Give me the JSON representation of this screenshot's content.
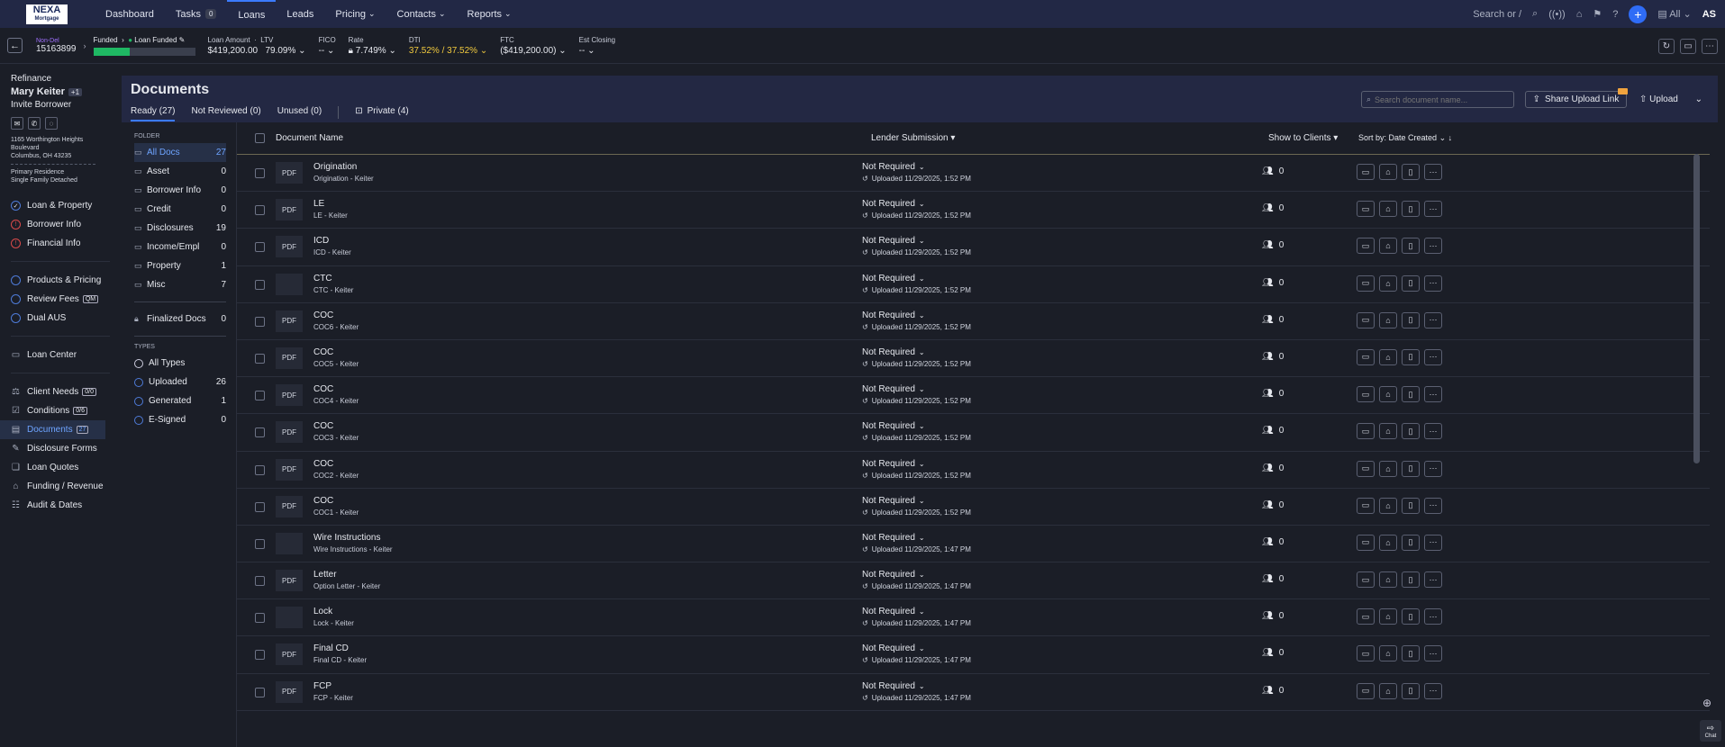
{
  "nav": {
    "logo_main": "NEXA",
    "logo_sub": "Mortgage",
    "items": [
      {
        "label": "Dashboard"
      },
      {
        "label": "Tasks",
        "badge": "0"
      },
      {
        "label": "Loans"
      },
      {
        "label": "Leads"
      },
      {
        "label": "Pricing",
        "chevron": "⌄"
      },
      {
        "label": "Contacts",
        "chevron": "⌄"
      },
      {
        "label": "Reports",
        "chevron": "⌄"
      }
    ],
    "search_placeholder": "Search or /",
    "scope": "All",
    "user_initials": "AS"
  },
  "status": {
    "loan_type_label": "Non-Del",
    "loan_number": "15163899",
    "stage": "Funded",
    "milestone": "Loan Funded",
    "loan_amount_label": "Loan Amount",
    "loan_amount": "$419,200.00",
    "ltv_label": "LTV",
    "ltv": "79.09%",
    "fico_label": "FICO",
    "fico": "--",
    "rate_label": "Rate",
    "rate": "7.749%",
    "dti_label": "DTI",
    "dti": "37.52% / 37.52%",
    "ftc_label": "FTC",
    "ftc": "($419,200.00)",
    "est_closing_label": "Est Closing",
    "est_closing": "--"
  },
  "borrower": {
    "purpose": "Refinance",
    "name": "Mary Keiter",
    "extra": "+1",
    "invite": "Invite Borrower",
    "address1": "1165 Worthington Heights",
    "address2": "Boulevard",
    "address3": "Columbus, OH 43235",
    "occupancy": "Primary Residence",
    "property_type": "Single Family Detached"
  },
  "sidebar": {
    "group1": [
      "Loan & Property",
      "Borrower Info",
      "Financial Info"
    ],
    "group2": [
      "Products & Pricing",
      "Review Fees",
      "Dual AUS"
    ],
    "review_fees_tag": "QM",
    "loan_center": "Loan Center",
    "group3": [
      {
        "label": "Client Needs",
        "tag": "0/0"
      },
      {
        "label": "Conditions",
        "tag": "0/6"
      },
      {
        "label": "Documents",
        "tag": "27"
      },
      {
        "label": "Disclosure Forms",
        "tag": ""
      },
      {
        "label": "Loan Quotes",
        "tag": ""
      },
      {
        "label": "Funding / Revenue",
        "tag": ""
      },
      {
        "label": "Audit & Dates",
        "tag": ""
      }
    ]
  },
  "docs": {
    "title": "Documents",
    "tabs": [
      "Ready (27)",
      "Not Reviewed (0)",
      "Unused (0)"
    ],
    "private_tab": "Private (4)",
    "search_placeholder": "Search document name...",
    "share_label": "Share Upload Link",
    "upload_label": "Upload"
  },
  "folders": {
    "label": "FOLDER",
    "items": [
      {
        "label": "All Docs",
        "count": "27"
      },
      {
        "label": "Asset",
        "count": "0"
      },
      {
        "label": "Borrower Info",
        "count": "0"
      },
      {
        "label": "Credit",
        "count": "0"
      },
      {
        "label": "Disclosures",
        "count": "19"
      },
      {
        "label": "Income/Empl",
        "count": "0"
      },
      {
        "label": "Property",
        "count": "1"
      },
      {
        "label": "Misc",
        "count": "7"
      }
    ],
    "finalized": {
      "label": "Finalized Docs",
      "count": "0"
    },
    "types_label": "TYPES",
    "types": [
      {
        "label": "All Types",
        "count": ""
      },
      {
        "label": "Uploaded",
        "count": "26"
      },
      {
        "label": "Generated",
        "count": "1"
      },
      {
        "label": "E-Signed",
        "count": "0"
      }
    ]
  },
  "table": {
    "col_name": "Document Name",
    "col_lender": "Lender Submission",
    "col_show": "Show to Clients",
    "sort_label": "Sort by:",
    "sort_value": "Date Created",
    "rows": [
      {
        "pdf": "PDF",
        "name": "Origination",
        "sub": "Origination - Keiter",
        "status": "Not Required",
        "uploaded": "Uploaded 11/29/2025, 1:52 PM",
        "share": "0"
      },
      {
        "pdf": "PDF",
        "name": "LE",
        "sub": "LE - Keiter",
        "status": "Not Required",
        "uploaded": "Uploaded 11/29/2025, 1:52 PM",
        "share": "0"
      },
      {
        "pdf": "PDF",
        "name": "ICD",
        "sub": "ICD - Keiter",
        "status": "Not Required",
        "uploaded": "Uploaded 11/29/2025, 1:52 PM",
        "share": "0"
      },
      {
        "pdf": "",
        "name": "CTC",
        "sub": "CTC - Keiter",
        "status": "Not Required",
        "uploaded": "Uploaded 11/29/2025, 1:52 PM",
        "share": "0"
      },
      {
        "pdf": "PDF",
        "name": "COC",
        "sub": "COC6 - Keiter",
        "status": "Not Required",
        "uploaded": "Uploaded 11/29/2025, 1:52 PM",
        "share": "0"
      },
      {
        "pdf": "PDF",
        "name": "COC",
        "sub": "COC5 - Keiter",
        "status": "Not Required",
        "uploaded": "Uploaded 11/29/2025, 1:52 PM",
        "share": "0"
      },
      {
        "pdf": "PDF",
        "name": "COC",
        "sub": "COC4 - Keiter",
        "status": "Not Required",
        "uploaded": "Uploaded 11/29/2025, 1:52 PM",
        "share": "0"
      },
      {
        "pdf": "PDF",
        "name": "COC",
        "sub": "COC3 - Keiter",
        "status": "Not Required",
        "uploaded": "Uploaded 11/29/2025, 1:52 PM",
        "share": "0"
      },
      {
        "pdf": "PDF",
        "name": "COC",
        "sub": "COC2 - Keiter",
        "status": "Not Required",
        "uploaded": "Uploaded 11/29/2025, 1:52 PM",
        "share": "0"
      },
      {
        "pdf": "PDF",
        "name": "COC",
        "sub": "COC1 - Keiter",
        "status": "Not Required",
        "uploaded": "Uploaded 11/29/2025, 1:52 PM",
        "share": "0"
      },
      {
        "pdf": "",
        "name": "Wire Instructions",
        "sub": "Wire Instructions - Keiter",
        "status": "Not Required",
        "uploaded": "Uploaded 11/29/2025, 1:47 PM",
        "share": "0"
      },
      {
        "pdf": "PDF",
        "name": "Letter",
        "sub": "Option Letter - Keiter",
        "status": "Not Required",
        "uploaded": "Uploaded 11/29/2025, 1:47 PM",
        "share": "0"
      },
      {
        "pdf": "",
        "name": "Lock",
        "sub": "Lock - Keiter",
        "status": "Not Required",
        "uploaded": "Uploaded 11/29/2025, 1:47 PM",
        "share": "0"
      },
      {
        "pdf": "PDF",
        "name": "Final CD",
        "sub": "Final CD - Keiter",
        "status": "Not Required",
        "uploaded": "Uploaded 11/29/2025, 1:47 PM",
        "share": "0"
      },
      {
        "pdf": "PDF",
        "name": "FCP",
        "sub": "FCP - Keiter",
        "status": "Not Required",
        "uploaded": "Uploaded 11/29/2025, 1:47 PM",
        "share": "0"
      }
    ]
  },
  "chat_label": "Chat",
  "colors": {
    "accent": "#3b7bff",
    "nav_bg": "#222845",
    "progress": "#1fb863",
    "dti": "#f0c93e"
  }
}
